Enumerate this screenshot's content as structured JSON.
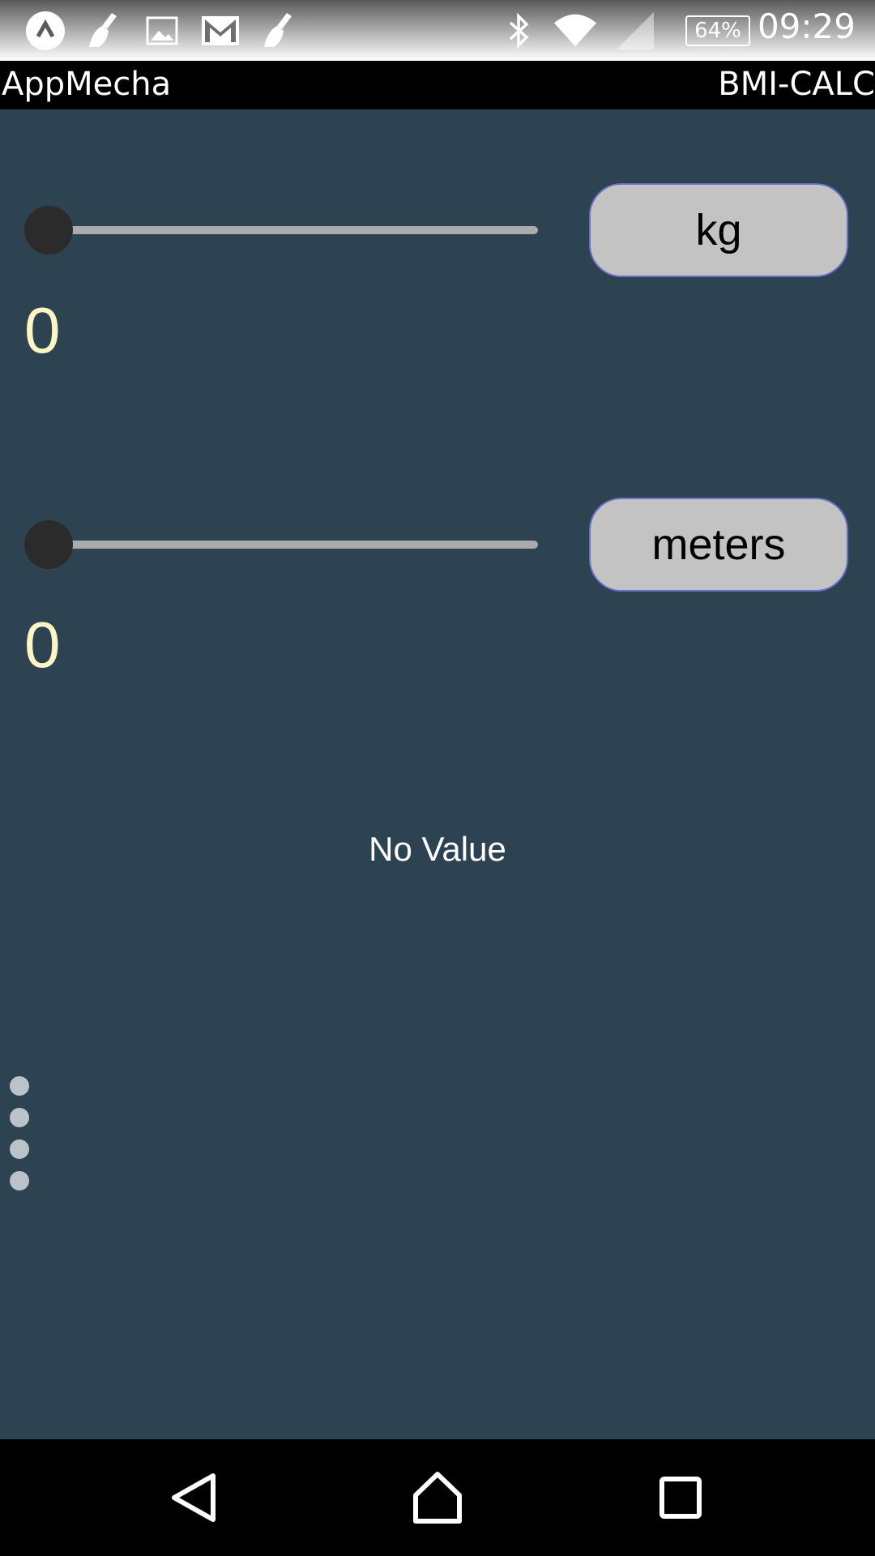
{
  "status_bar": {
    "battery_percent": "64%",
    "time": "09:29",
    "icons": [
      "app-launcher-icon",
      "cleaner-icon",
      "image-icon",
      "gmail-icon",
      "cleaner-icon",
      "bluetooth-icon",
      "wifi-icon",
      "signal-icon",
      "battery-icon"
    ]
  },
  "app_bar": {
    "title": "AppMecha",
    "subtitle": "BMI-CALC"
  },
  "weight": {
    "slider_value": 0,
    "unit_label": "kg",
    "value_text": "0"
  },
  "height": {
    "slider_value": 0,
    "unit_label": "meters",
    "value_text": "0"
  },
  "result": {
    "text": "No Value"
  },
  "nav_bar": {
    "icons": [
      "back-icon",
      "home-icon",
      "recents-icon"
    ]
  },
  "colors": {
    "background": "#2e4351",
    "value_text": "#fdf5c4",
    "button_fill": "#c3c3c3",
    "button_border": "#6b6fc7",
    "slider_track": "#a9abac",
    "slider_thumb": "#2b2b2b"
  }
}
